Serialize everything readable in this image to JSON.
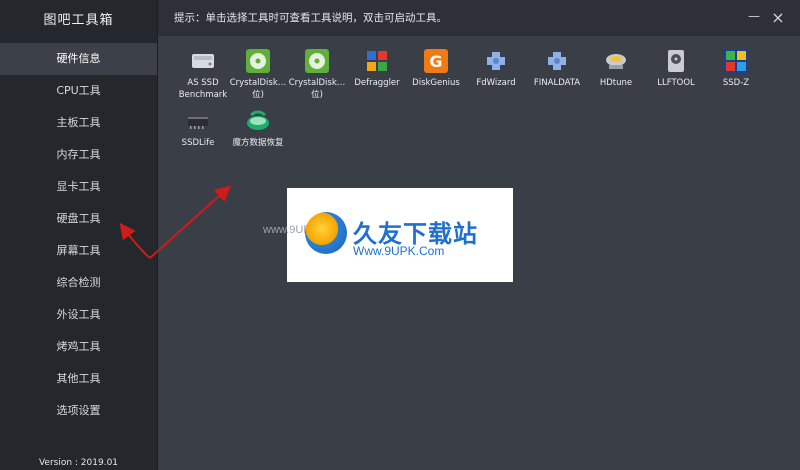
{
  "sidebar": {
    "app_title": "图吧工具箱",
    "items": [
      {
        "label": "硬件信息",
        "active": true
      },
      {
        "label": "CPU工具"
      },
      {
        "label": "主板工具"
      },
      {
        "label": "内存工具"
      },
      {
        "label": "显卡工具"
      },
      {
        "label": "硬盘工具"
      },
      {
        "label": "屏幕工具"
      },
      {
        "label": "综合检测"
      },
      {
        "label": "外设工具"
      },
      {
        "label": "烤鸡工具"
      },
      {
        "label": "其他工具"
      },
      {
        "label": "选项设置"
      }
    ],
    "version": "Version : 2019.01"
  },
  "topbar": {
    "hint": "提示：单击选择工具时可查看工具说明，双击可启动工具。",
    "min_glyph": "—",
    "close_glyph": "×"
  },
  "tools": [
    {
      "label": "AS SSD\nBenchmark",
      "icon": "drive-icon"
    },
    {
      "label": "CrystalDisk…\n位)",
      "icon": "crystaldisk-icon"
    },
    {
      "label": "CrystalDisk…\n位)",
      "icon": "crystaldisk-icon"
    },
    {
      "label": "Defraggler",
      "icon": "defraggler-icon"
    },
    {
      "label": "DiskGenius",
      "icon": "diskgenius-icon"
    },
    {
      "label": "FdWizard",
      "icon": "puzzle-icon"
    },
    {
      "label": "FINALDATA",
      "icon": "puzzle-icon"
    },
    {
      "label": "HDtune",
      "icon": "hdtune-icon"
    },
    {
      "label": "LLFTOOL",
      "icon": "hdd-icon"
    },
    {
      "label": "SSD-Z",
      "icon": "ssdz-icon"
    },
    {
      "label": "SSDLife",
      "icon": "ssd-chip-icon"
    },
    {
      "label": "魔方数据恢复",
      "icon": "recovery-icon"
    }
  ],
  "watermark": {
    "url_text": "www.9UPK.com",
    "brand": "久友下载站",
    "domain": "Www.9UPK.Com"
  },
  "colors": {
    "sidebar_bg": "#24272c",
    "main_bg": "#3a3e47",
    "active_bg": "#3c4049",
    "arrow": "#d11a1a",
    "brand_blue": "#1f6fd0"
  }
}
